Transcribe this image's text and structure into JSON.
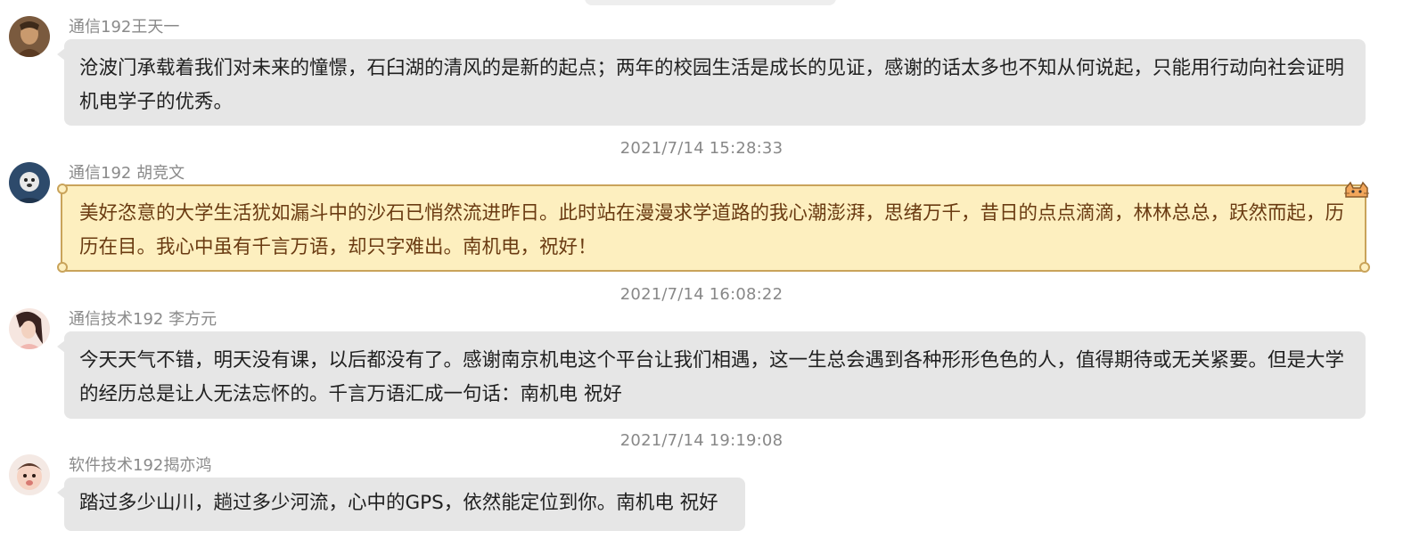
{
  "messages": [
    {
      "sender": "通信192王天一",
      "text": "沧波门承载着我们对未来的憧憬，石臼湖的清风的是新的起点；两年的校园生活是成长的见证，感谢的话太多也不知从何说起，只能用行动向社会证明机电学子的优秀。"
    },
    {
      "timestamp": "2021/7/14 15:28:33",
      "sender": "通信192 胡竞文",
      "text": "美好恣意的大学生活犹如漏斗中的沙石已悄然流进昨日。此时站在漫漫求学道路的我心潮澎湃，思绪万千，昔日的点点滴滴，林林总总，跃然而起，历历在目。我心中虽有千言万语，却只字难出。南机电，祝好！",
      "bubble_style": "scroll"
    },
    {
      "timestamp": "2021/7/14 16:08:22",
      "sender": "通信技术192 李方元",
      "text": "今天天气不错，明天没有课，以后都没有了。感谢南京机电这个平台让我们相遇，这一生总会遇到各种形形色色的人，值得期待或无关紧要。但是大学的经历总是让人无法忘怀的。千言万语汇成一句话：南机电 祝好"
    },
    {
      "timestamp": "2021/7/14 19:19:08",
      "sender": "软件技术192揭亦鸿",
      "text": "踏过多少山川，趟过多少河流，心中的GPS，依然能定位到你。南机电 祝好"
    }
  ],
  "colors": {
    "bubble": "#e6e6e6",
    "scroll_bubble": "#fdefbf",
    "scroll_border": "#c9a35a",
    "scroll_text": "#6a3b12",
    "timestamp": "#888888",
    "sender": "#8a8a8a"
  },
  "icons": [
    "avatar-photo",
    "cat-corner-ornament"
  ]
}
